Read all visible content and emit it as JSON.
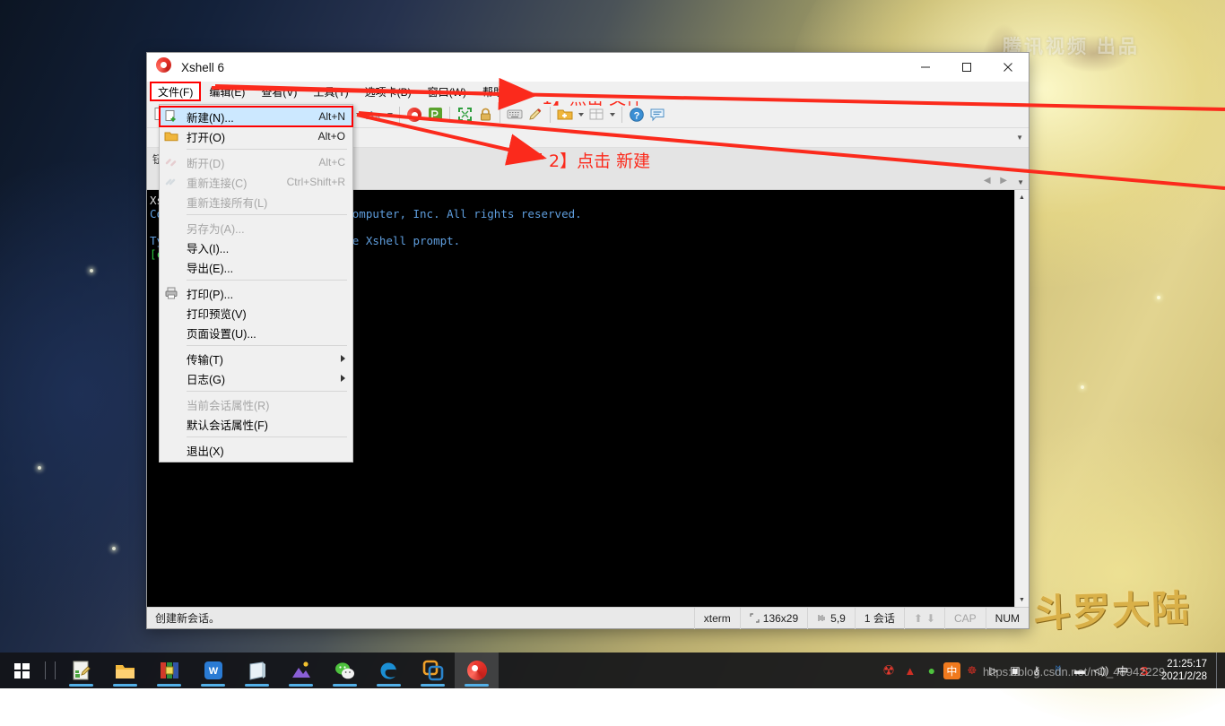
{
  "window": {
    "title": "Xshell 6",
    "app_icon": "xshell-spiral-icon",
    "minimize": "—",
    "maximize": "☐",
    "close": "✕"
  },
  "menubar": {
    "items": [
      {
        "label": "文件(F)",
        "name": "menu-file",
        "active": true
      },
      {
        "label": "编辑(E)",
        "name": "menu-edit",
        "active": false
      },
      {
        "label": "查看(V)",
        "name": "menu-view",
        "active": false
      },
      {
        "label": "工具(T)",
        "name": "menu-tools",
        "active": false
      },
      {
        "label": "选项卡(B)",
        "name": "menu-tabs",
        "active": false
      },
      {
        "label": "窗口(W)",
        "name": "menu-window",
        "active": false
      },
      {
        "label": "帮助(H)",
        "name": "menu-help",
        "active": false
      }
    ]
  },
  "file_menu": {
    "groups": [
      [
        {
          "label": "新建(N)...",
          "accel": "Alt+N",
          "icon": "new-session-icon",
          "disabled": false,
          "selected": true,
          "submenu": false
        },
        {
          "label": "打开(O)",
          "accel": "Alt+O",
          "icon": "folder-open-icon",
          "disabled": false,
          "selected": false,
          "submenu": false
        }
      ],
      [
        {
          "label": "断开(D)",
          "accel": "Alt+C",
          "icon": "disconnect-icon",
          "disabled": true,
          "selected": false,
          "submenu": false
        },
        {
          "label": "重新连接(C)",
          "accel": "Ctrl+Shift+R",
          "icon": "reconnect-icon",
          "disabled": true,
          "selected": false,
          "submenu": false
        },
        {
          "label": "重新连接所有(L)",
          "accel": "",
          "icon": "",
          "disabled": true,
          "selected": false,
          "submenu": false
        }
      ],
      [
        {
          "label": "另存为(A)...",
          "accel": "",
          "icon": "",
          "disabled": true,
          "selected": false,
          "submenu": false
        },
        {
          "label": "导入(I)...",
          "accel": "",
          "icon": "",
          "disabled": false,
          "selected": false,
          "submenu": false
        },
        {
          "label": "导出(E)...",
          "accel": "",
          "icon": "",
          "disabled": false,
          "selected": false,
          "submenu": false
        }
      ],
      [
        {
          "label": "打印(P)...",
          "accel": "",
          "icon": "printer-icon",
          "disabled": false,
          "selected": false,
          "submenu": false
        },
        {
          "label": "打印预览(V)",
          "accel": "",
          "icon": "",
          "disabled": false,
          "selected": false,
          "submenu": false
        },
        {
          "label": "页面设置(U)...",
          "accel": "",
          "icon": "",
          "disabled": false,
          "selected": false,
          "submenu": false
        }
      ],
      [
        {
          "label": "传输(T)",
          "accel": "",
          "icon": "",
          "disabled": false,
          "selected": false,
          "submenu": true
        },
        {
          "label": "日志(G)",
          "accel": "",
          "icon": "",
          "disabled": false,
          "selected": false,
          "submenu": true
        }
      ],
      [
        {
          "label": "当前会话属性(R)",
          "accel": "",
          "icon": "",
          "disabled": true,
          "selected": false,
          "submenu": false
        },
        {
          "label": "默认会话属性(F)",
          "accel": "",
          "icon": "",
          "disabled": false,
          "selected": false,
          "submenu": false
        }
      ],
      [
        {
          "label": "退出(X)",
          "accel": "",
          "icon": "",
          "disabled": false,
          "selected": false,
          "submenu": false
        }
      ]
    ]
  },
  "toolbar": {
    "items": [
      {
        "name": "new-session-toolbar-button",
        "icon": "new-file-icon",
        "dropdown": false
      },
      {
        "name": "open-session-toolbar-button",
        "icon": "folder-open-icon",
        "dropdown": false
      },
      {
        "name": "sep-1",
        "icon": "separator",
        "dropdown": false
      },
      {
        "name": "disconnect-toolbar-button",
        "icon": "disconnect-icon",
        "dropdown": false
      },
      {
        "name": "reconnect-toolbar-button",
        "icon": "reconnect-icon",
        "dropdown": false
      },
      {
        "name": "sep-2",
        "icon": "separator",
        "dropdown": false
      },
      {
        "name": "copy-toolbar-button",
        "icon": "copy-icon",
        "dropdown": false
      },
      {
        "name": "paste-toolbar-button",
        "icon": "paste-icon",
        "dropdown": false
      },
      {
        "name": "sep-3",
        "icon": "separator",
        "dropdown": false
      },
      {
        "name": "find-toolbar-button",
        "icon": "search-icon",
        "dropdown": true
      },
      {
        "name": "globe-toolbar-button",
        "icon": "globe-icon",
        "dropdown": true
      },
      {
        "name": "font-toolbar-button",
        "icon": "font-icon",
        "dropdown": true
      },
      {
        "name": "sep-4",
        "icon": "separator",
        "dropdown": false
      },
      {
        "name": "xshell-toolbar-button",
        "icon": "xshell-spiral-icon",
        "dropdown": false
      },
      {
        "name": "xftp-toolbar-button",
        "icon": "xftp-icon",
        "dropdown": false
      },
      {
        "name": "sep-5",
        "icon": "separator",
        "dropdown": false
      },
      {
        "name": "fullscreen-toolbar-button",
        "icon": "fullscreen-icon",
        "dropdown": false
      },
      {
        "name": "lock-toolbar-button",
        "icon": "lock-icon",
        "dropdown": false
      },
      {
        "name": "sep-6",
        "icon": "separator",
        "dropdown": false
      },
      {
        "name": "keyboard-toolbar-button",
        "icon": "keyboard-icon",
        "dropdown": false
      },
      {
        "name": "highlight-toolbar-button",
        "icon": "pencil-icon",
        "dropdown": false
      },
      {
        "name": "sep-7",
        "icon": "separator",
        "dropdown": false
      },
      {
        "name": "add-folder-toolbar-button",
        "icon": "add-folder-icon",
        "dropdown": true
      },
      {
        "name": "layout-toolbar-button",
        "icon": "layout-grid-icon",
        "dropdown": true
      },
      {
        "name": "sep-8",
        "icon": "separator",
        "dropdown": false
      },
      {
        "name": "help-toolbar-button",
        "icon": "help-circle-icon",
        "dropdown": false
      },
      {
        "name": "feedback-toolbar-button",
        "icon": "speech-bubble-icon",
        "dropdown": false
      }
    ]
  },
  "info_pane": {
    "tip_text": "钮。",
    "nav_left": "◀",
    "nav_right": "▶"
  },
  "terminal": {
    "lines": [
      {
        "text": "Xshell 6 (Build 0095)",
        "color": "white"
      },
      {
        "text": "Copyright (c) 2002 NetSarang Computer, Inc. All rights reserved.",
        "color": "blue"
      },
      {
        "text": "",
        "color": "white"
      },
      {
        "text": "Type `help' to learn how to use Xshell prompt.",
        "color": "blue"
      },
      {
        "text": "[c:\\~]$",
        "color": "green"
      }
    ]
  },
  "statusbar": {
    "message": "创建新会话。",
    "terminal_type": "xterm",
    "size_icon": "resize-icon",
    "size": "136x29",
    "cursor_icon": "cursor-icon",
    "cursor": "5,9",
    "sessions": "1 会话",
    "up_arrow": "⬆",
    "down_arrow": "⬇",
    "cap": "CAP",
    "num": "NUM"
  },
  "annotations": [
    {
      "name": "annotation-step-1",
      "text": "1】点击 文件"
    },
    {
      "name": "annotation-step-2",
      "text": "2】点击 新建"
    }
  ],
  "taskbar": {
    "start_icon": "windows-start-icon",
    "buttons": [
      {
        "name": "taskbar-notepad-plus",
        "icon": "editor-icon",
        "active": false
      },
      {
        "name": "taskbar-file-explorer",
        "icon": "folder-icon",
        "active": false
      },
      {
        "name": "taskbar-winrar",
        "icon": "winrar-icon",
        "active": false
      },
      {
        "name": "taskbar-wps",
        "icon": "wps-writer-icon",
        "active": false
      },
      {
        "name": "taskbar-notes",
        "icon": "notes-icon",
        "active": false
      },
      {
        "name": "taskbar-photos",
        "icon": "photos-icon",
        "active": false
      },
      {
        "name": "taskbar-wechat",
        "icon": "wechat-icon",
        "active": false
      },
      {
        "name": "taskbar-edge",
        "icon": "edge-browser-icon",
        "active": false
      },
      {
        "name": "taskbar-vmware",
        "icon": "vmware-icon",
        "active": false
      },
      {
        "name": "taskbar-xshell",
        "icon": "xshell-spiral-icon",
        "active": true
      }
    ],
    "tray": [
      {
        "name": "tray-360-icon",
        "glyph": "☢"
      },
      {
        "name": "tray-lenovo-icon",
        "glyph": "▲"
      },
      {
        "name": "tray-wechat-icon",
        "glyph": "●"
      },
      {
        "name": "tray-ime-icon",
        "glyph": "中"
      },
      {
        "name": "tray-nvidia-icon",
        "glyph": "☸"
      },
      {
        "name": "tray-screen-record-icon",
        "glyph": "▶"
      },
      {
        "name": "tray-camera-icon",
        "glyph": "▣"
      },
      {
        "name": "tray-usb-icon",
        "glyph": "⑂"
      },
      {
        "name": "tray-bluetooth-icon",
        "glyph": "ᛗ"
      },
      {
        "name": "tray-battery-icon",
        "glyph": "▬"
      },
      {
        "name": "tray-volume-icon",
        "glyph": "🔊"
      },
      {
        "name": "tray-ime-mode-icon",
        "glyph": "中"
      },
      {
        "name": "tray-xshell-icon",
        "glyph": "S"
      }
    ],
    "clock_time": "21:25:17",
    "clock_date": "2021/2/28"
  },
  "watermarks": {
    "blog_url": "https://blog.csdn.net/m0_48942229",
    "desktop_tencent": "腾讯视频 出品",
    "desktop_title": "斗罗大陆"
  }
}
